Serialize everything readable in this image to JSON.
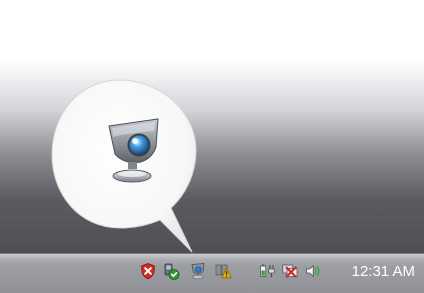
{
  "taskbar": {
    "clock": "12:31 AM"
  },
  "callout": {
    "icon": "webcam-icon"
  },
  "tray": {
    "icons": [
      "security-alert-icon",
      "network-check-icon",
      "webcam-tray-icon",
      "warning-icon",
      "power-icon",
      "network-disconnected-icon",
      "volume-icon"
    ]
  },
  "colors": {
    "taskbar_top": "#c9cbcf",
    "taskbar_bottom": "#909297",
    "clock_text": "#ffffff",
    "alert_red": "#d42a24",
    "check_green": "#2f9a2f",
    "warning_yellow": "#f0b400"
  }
}
